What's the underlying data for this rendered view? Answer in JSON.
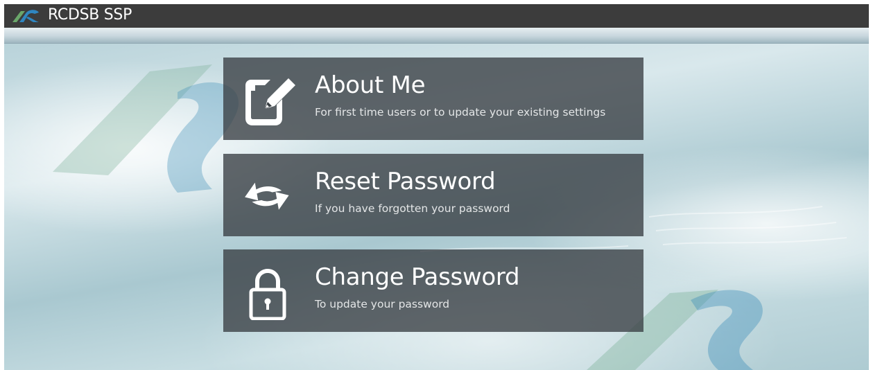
{
  "header": {
    "title": "RCDSB SSP",
    "logo_icon": "rcdsb-logo-icon"
  },
  "tiles": [
    {
      "title": "About Me",
      "description": "For first time users or to update your existing settings",
      "icon": "edit-document-icon"
    },
    {
      "title": "Reset Password",
      "description": "If you have forgotten your password",
      "icon": "refresh-arrows-icon"
    },
    {
      "title": "Change Password",
      "description": "To update your password",
      "icon": "padlock-icon"
    }
  ],
  "colors": {
    "header_bg": "#3c3c3c",
    "tile_bg": "#383e42",
    "logo_green": "#6aa66a",
    "logo_blue": "#2f86c1"
  }
}
